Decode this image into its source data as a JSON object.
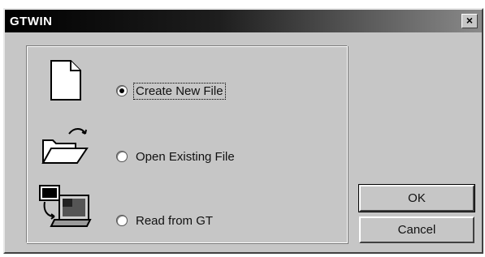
{
  "window": {
    "title": "GTWIN",
    "close_label": "×"
  },
  "options": [
    {
      "label": "Create New File",
      "selected": true,
      "icon": "new-file-icon"
    },
    {
      "label": "Open Existing File",
      "selected": false,
      "icon": "open-folder-icon"
    },
    {
      "label": "Read from GT",
      "selected": false,
      "icon": "read-from-gt-icon"
    }
  ],
  "buttons": {
    "ok_label": "OK",
    "cancel_label": "Cancel"
  }
}
